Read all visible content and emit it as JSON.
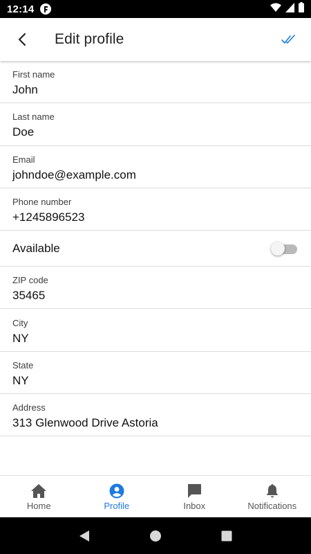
{
  "status_bar": {
    "time": "12:14",
    "icons": [
      "app-notification-icon",
      "wifi-icon",
      "signal-icon",
      "battery-icon"
    ]
  },
  "app_bar": {
    "title": "Edit profile",
    "back_icon": "back-arrow-icon",
    "save_icon": "double-check-icon",
    "accent_color": "#1e7ae0"
  },
  "form": {
    "first_name": {
      "label": "First name",
      "value": "John"
    },
    "last_name": {
      "label": "Last name",
      "value": "Doe"
    },
    "email": {
      "label": "Email",
      "value": "johndoe@example.com"
    },
    "phone": {
      "label": "Phone number",
      "value": "+1245896523"
    },
    "available": {
      "label": "Available",
      "checked": false
    },
    "zip": {
      "label": "ZIP code",
      "value": "35465"
    },
    "city": {
      "label": "City",
      "value": "NY"
    },
    "state": {
      "label": "State",
      "value": "NY"
    },
    "address": {
      "label": "Address",
      "value": "313 Glenwood Drive Astoria"
    }
  },
  "bottom_nav": {
    "items": [
      {
        "label": "Home",
        "icon": "home-icon",
        "active": false
      },
      {
        "label": "Profile",
        "icon": "account-circle-icon",
        "active": true
      },
      {
        "label": "Inbox",
        "icon": "chat-bubble-icon",
        "active": false
      },
      {
        "label": "Notifications",
        "icon": "bell-icon",
        "active": false
      }
    ]
  },
  "system_nav": {
    "icons": [
      "back-triangle-icon",
      "home-circle-icon",
      "recents-square-icon"
    ]
  }
}
